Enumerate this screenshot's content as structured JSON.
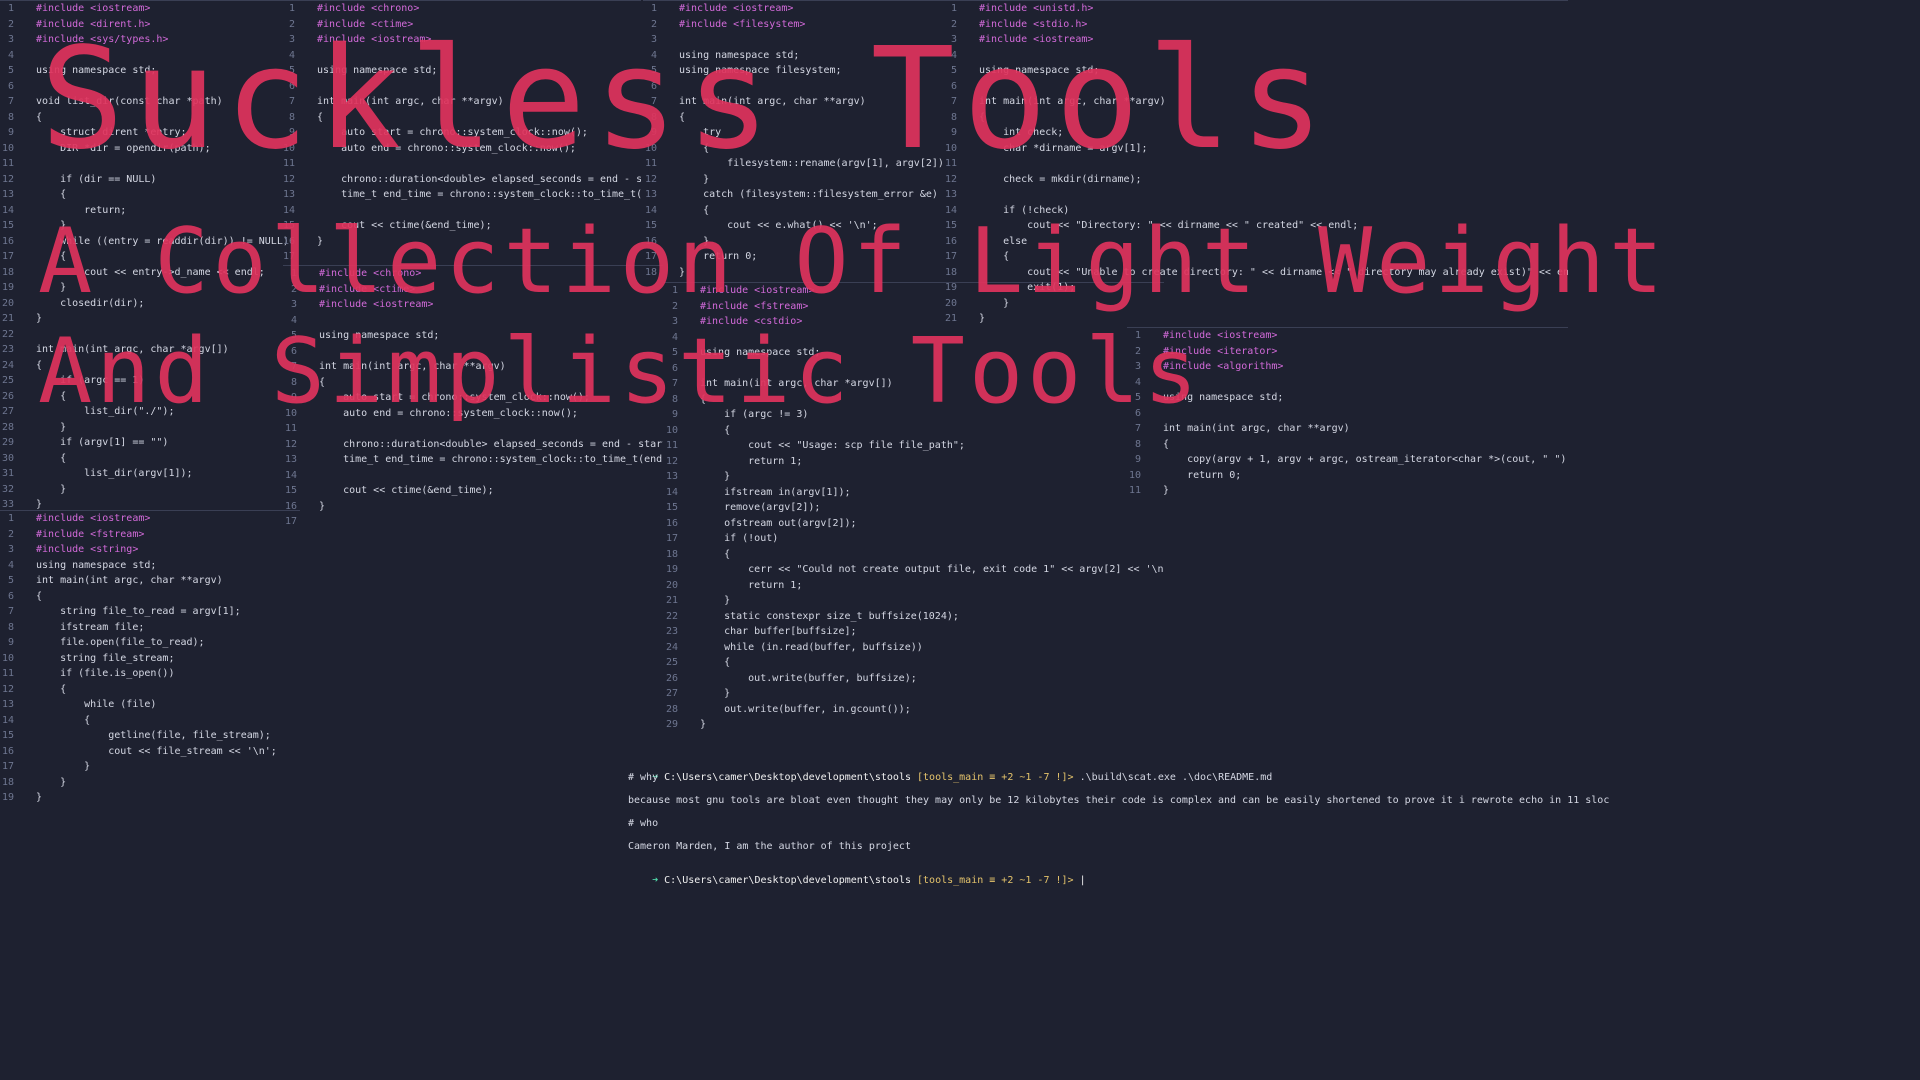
{
  "title": {
    "line1": "Suckless Tools",
    "line2": "A Collection Of Light Weight",
    "line3": "And Simplistic Tools"
  },
  "colors": {
    "background": "#1e2130",
    "title": "#e0335d",
    "keyword": "#d26ad9",
    "type": "#e6b450",
    "function": "#8fd06e",
    "string": "#a5e075",
    "prompt": "#4fd5a7"
  },
  "panes": [
    {
      "id": "ls",
      "lines": [
        "#include <iostream>",
        "#include <dirent.h>",
        "#include <sys/types.h>",
        "",
        "using namespace std;",
        "",
        "void list_dir(const char *path)",
        "{",
        "    struct dirent *entry;",
        "    DIR *dir = opendir(path);",
        "",
        "    if (dir == NULL)",
        "    {",
        "        return;",
        "    }",
        "    while ((entry = readdir(dir)) != NULL)",
        "    {",
        "        cout << entry->d_name << endl;",
        "    }",
        "    closedir(dir);",
        "}",
        "",
        "int main(int argc, char *argv[])",
        "{",
        "    if (argc == 1)",
        "    {",
        "        list_dir(\"./\");",
        "    }",
        "    if (argv[1] == \"\")",
        "    {",
        "        list_dir(argv[1]);",
        "    }",
        "}"
      ]
    },
    {
      "id": "cat",
      "lines": [
        "#include <iostream>",
        "#include <fstream>",
        "#include <string>",
        "using namespace std;",
        "int main(int argc, char **argv)",
        "{",
        "    string file_to_read = argv[1];",
        "    ifstream file;",
        "    file.open(file_to_read);",
        "    string file_stream;",
        "    if (file.is_open())",
        "    {",
        "        while (file)",
        "        {",
        "            getline(file, file_stream);",
        "            cout << file_stream << '\\n';",
        "        }",
        "    }",
        "}"
      ]
    },
    {
      "id": "time1",
      "lines": [
        "#include <chrono>",
        "#include <ctime>",
        "#include <iostream>",
        "",
        "using namespace std;",
        "",
        "int main(int argc, char **argv)",
        "{",
        "    auto start = chrono::system_clock::now();",
        "    auto end = chrono::system_clock::now();",
        "",
        "    chrono::duration<double> elapsed_seconds = end - start;",
        "    time_t end_time = chrono::system_clock::to_time_t(end);",
        "",
        "    cout << ctime(&end_time);",
        "}",
        ""
      ]
    },
    {
      "id": "time2",
      "lines": [
        "#include <chrono>",
        "#include <ctime>",
        "#include <iostream>",
        "",
        "using namespace std;",
        "",
        "int main(int argc, char **argv)",
        "{",
        "    auto start = chrono::system_clock::now();",
        "    auto end = chrono::system_clock::now();",
        "",
        "    chrono::duration<double> elapsed_seconds = end - start;",
        "    time_t end_time = chrono::system_clock::to_time_t(end);",
        "",
        "    cout << ctime(&end_time);",
        "}",
        ""
      ]
    },
    {
      "id": "mv",
      "lines": [
        "#include <iostream>",
        "#include <filesystem>",
        "",
        "using namespace std;",
        "using namespace filesystem;",
        "",
        "int main(int argc, char **argv)",
        "{",
        "    try",
        "    {",
        "        filesystem::rename(argv[1], argv[2]);",
        "    }",
        "    catch (filesystem::filesystem_error &e)",
        "    {",
        "        cout << e.what() << '\\n';",
        "    }",
        "    return 0;",
        "}"
      ]
    },
    {
      "id": "cp",
      "lines": [
        "#include <iostream>",
        "#include <fstream>",
        "#include <cstdio>",
        "",
        "using namespace std;",
        "",
        "int main(int argc, char *argv[])",
        "{",
        "    if (argc != 3)",
        "    {",
        "        cout << \"Usage: scp file file_path\";",
        "        return 1;",
        "    }",
        "    ifstream in(argv[1]);",
        "    remove(argv[2]);",
        "    ofstream out(argv[2]);",
        "    if (!out)",
        "    {",
        "        cerr << \"Could not create output file, exit code 1\" << argv[2] << '\\n';",
        "        return 1;",
        "    }",
        "    static constexpr size_t buffsize(1024);",
        "    char buffer[buffsize];",
        "    while (in.read(buffer, buffsize))",
        "    {",
        "        out.write(buffer, buffsize);",
        "    }",
        "    out.write(buffer, in.gcount());",
        "}"
      ]
    },
    {
      "id": "mkdir",
      "lines": [
        "#include <unistd.h>",
        "#include <stdio.h>",
        "#include <iostream>",
        "",
        "using namespace std;",
        "",
        "int main(int argc, char **argv)",
        "{",
        "    int check;",
        "    char *dirname = argv[1];",
        "",
        "    check = mkdir(dirname);",
        "",
        "    if (!check)",
        "        cout << \"Directory: \" << dirname << \" created\" << endl;",
        "    else",
        "    {",
        "        cout << \"Unable to create directory: \" << dirname << \" directory may already exist)\" << endl;",
        "        exit(1);",
        "    }",
        "}"
      ]
    },
    {
      "id": "echo",
      "lines": [
        "#include <iostream>",
        "#include <iterator>",
        "#include <algorithm>",
        "",
        "using namespace std;",
        "",
        "int main(int argc, char **argv)",
        "{",
        "    copy(argv + 1, argv + argc, ostream_iterator<char *>(cout, \" \"));",
        "    return 0;",
        "}"
      ]
    }
  ],
  "terminal": {
    "prompt_path": "C:\\Users\\camer\\Desktop\\development\\stools",
    "branch": "[tools_main ≡ +2 ~1 -7 !]>",
    "command": ".\\build\\scat.exe .\\doc\\README.md",
    "output": [
      "# why",
      "",
      "because most gnu tools are bloat even thought they may only be 12 kilobytes their code is complex and can be easily shortened to prove it i rewrote echo in 11 sloc",
      "",
      "# who",
      "",
      "Cameron Marden, I am the author of this project",
      ""
    ],
    "cursor": "|"
  }
}
